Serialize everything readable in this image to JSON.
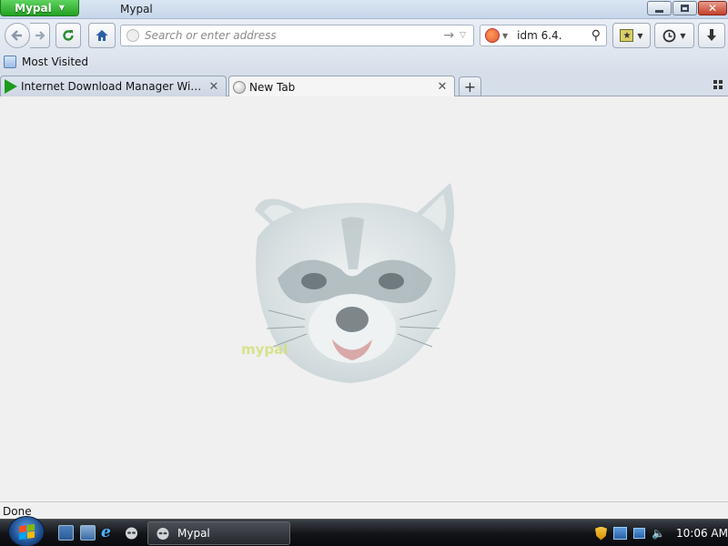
{
  "titlebar": {
    "app_button": "Mypal",
    "window_title": "Mypal"
  },
  "navbar": {
    "url_placeholder": "Search or enter address",
    "search_value": "idm 6.4."
  },
  "bookmarks": {
    "most_visited": "Most Visited"
  },
  "tabs": [
    {
      "label": "Internet Download Manager Window...",
      "icon": "idm-play-icon",
      "active": false
    },
    {
      "label": "New Tab",
      "icon": "globe-icon",
      "active": true
    }
  ],
  "newtab_symbol": "+",
  "content": {
    "logo_text": "mypal"
  },
  "status": {
    "text": "Done"
  },
  "taskbar": {
    "task_label": "Mypal",
    "clock": "10:06 AM"
  },
  "colors": {
    "app_button": "#23a023",
    "titlebar": "#c6d6ea",
    "content_bg": "#f0f0f0",
    "taskbar": "#111317"
  }
}
